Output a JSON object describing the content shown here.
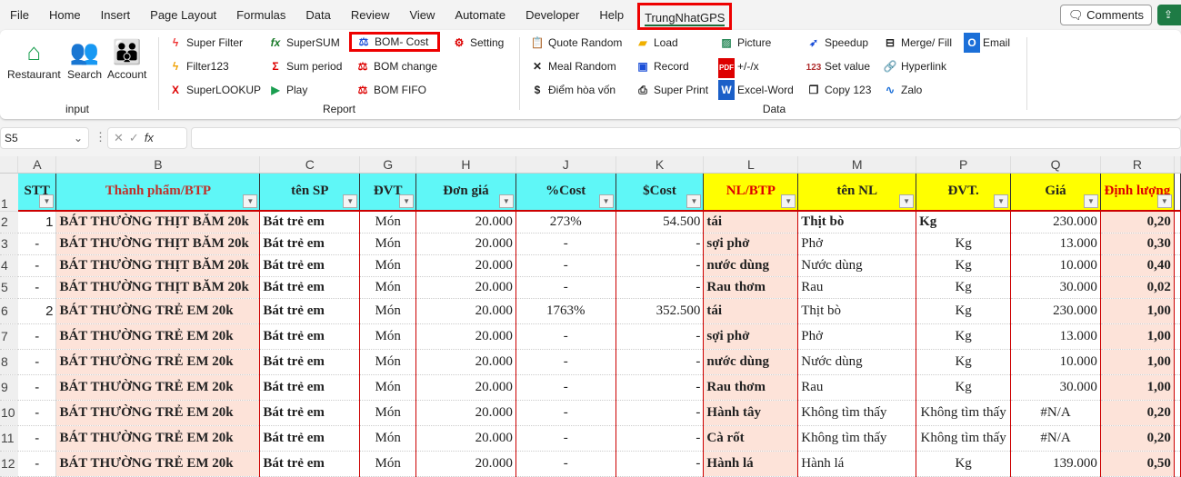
{
  "menu": [
    "File",
    "Home",
    "Insert",
    "Page Layout",
    "Formulas",
    "Data",
    "Review",
    "View",
    "Automate",
    "Developer",
    "Help",
    "TrungNhatGPS"
  ],
  "comments": "Comments",
  "ribbon": {
    "input": {
      "label": "input",
      "items": [
        "Restaurant",
        "Search",
        "Account"
      ]
    },
    "report": {
      "label": "Report",
      "items": [
        "Super Filter",
        "Filter123",
        "SuperLOOKUP",
        "SuperSUM",
        "Sum period",
        "Play",
        "BOM- Cost",
        "BOM change",
        "BOM FIFO",
        "Setting"
      ]
    },
    "data": {
      "label": "Data",
      "items": [
        "Quote Random",
        "Meal Random",
        "Điểm hòa vốn",
        "Load",
        "Record",
        "Super Print",
        "Picture",
        "+/-/x",
        "Excel-Word",
        "Speedup",
        "Set value",
        "Copy 123",
        "Merge/ Fill",
        "Hyperlink",
        "Zalo",
        "Email"
      ]
    }
  },
  "namebox": "S5",
  "columns": [
    "A",
    "B",
    "C",
    "G",
    "H",
    "J",
    "K",
    "L",
    "M",
    "P",
    "Q",
    "R"
  ],
  "headers": [
    "STT",
    "Thành phẩm/BTP",
    "tên SP",
    "ĐVT",
    "Đơn giá",
    "%Cost",
    "$Cost",
    "NL/BTP",
    "tên NL",
    "ĐVT.",
    "Giá",
    "Định lượng"
  ],
  "rows": [
    {
      "n": "2",
      "cells": [
        "1",
        "BÁT THƯỜNG THỊT BĂM 20k",
        "Bát trẻ em",
        "Món",
        "20.000",
        "273%",
        "54.500",
        "tái",
        "Thịt bò",
        "Kg",
        "230.000",
        "0,20"
      ]
    },
    {
      "n": "3",
      "cells": [
        "-",
        "BÁT THƯỜNG THỊT BĂM 20k",
        "Bát trẻ em",
        "Món",
        "20.000",
        "-",
        "-",
        "sợi phở",
        "Phở",
        "Kg",
        "13.000",
        "0,30"
      ]
    },
    {
      "n": "4",
      "cells": [
        "-",
        "BÁT THƯỜNG THỊT BĂM 20k",
        "Bát trẻ em",
        "Món",
        "20.000",
        "-",
        "-",
        "nước dùng",
        "Nước dùng",
        "Kg",
        "10.000",
        "0,40"
      ]
    },
    {
      "n": "5",
      "cells": [
        "-",
        "BÁT THƯỜNG THỊT BĂM 20k",
        "Bát trẻ em",
        "Món",
        "20.000",
        "-",
        "-",
        "Rau thơm",
        "Rau",
        "Kg",
        "30.000",
        "0,02"
      ]
    },
    {
      "n": "6",
      "cells": [
        "2",
        "BÁT THƯỜNG TRẺ EM 20k",
        "Bát trẻ em",
        "Món",
        "20.000",
        "1763%",
        "352.500",
        "tái",
        "Thịt bò",
        "Kg",
        "230.000",
        "1,00"
      ]
    },
    {
      "n": "7",
      "cells": [
        "-",
        "BÁT THƯỜNG TRẺ EM 20k",
        "Bát trẻ em",
        "Món",
        "20.000",
        "-",
        "-",
        "sợi phở",
        "Phở",
        "Kg",
        "13.000",
        "1,00"
      ]
    },
    {
      "n": "8",
      "cells": [
        "-",
        "BÁT THƯỜNG TRẺ EM 20k",
        "Bát trẻ em",
        "Món",
        "20.000",
        "-",
        "-",
        "nước dùng",
        "Nước dùng",
        "Kg",
        "10.000",
        "1,00"
      ]
    },
    {
      "n": "9",
      "cells": [
        "-",
        "BÁT THƯỜNG TRẺ EM 20k",
        "Bát trẻ em",
        "Món",
        "20.000",
        "-",
        "-",
        "Rau thơm",
        "Rau",
        "Kg",
        "30.000",
        "1,00"
      ]
    },
    {
      "n": "10",
      "cells": [
        "-",
        "BÁT THƯỜNG TRẺ EM 20k",
        "Bát trẻ em",
        "Món",
        "20.000",
        "-",
        "-",
        "Hành tây",
        "Không tìm thấy",
        "Không tìm thấy",
        "#N/A",
        "0,20"
      ]
    },
    {
      "n": "11",
      "cells": [
        "-",
        "BÁT THƯỜNG TRẺ EM 20k",
        "Bát trẻ em",
        "Món",
        "20.000",
        "-",
        "-",
        "Cà rốt",
        "Không tìm thấy",
        "Không tìm thấy",
        "#N/A",
        "0,20"
      ]
    },
    {
      "n": "12",
      "cells": [
        "-",
        "BÁT THƯỜNG TRẺ EM 20k",
        "Bát trẻ em",
        "Món",
        "20.000",
        "-",
        "-",
        "Hành lá",
        "Hành lá",
        "Kg",
        "139.000",
        "0,50"
      ]
    }
  ]
}
